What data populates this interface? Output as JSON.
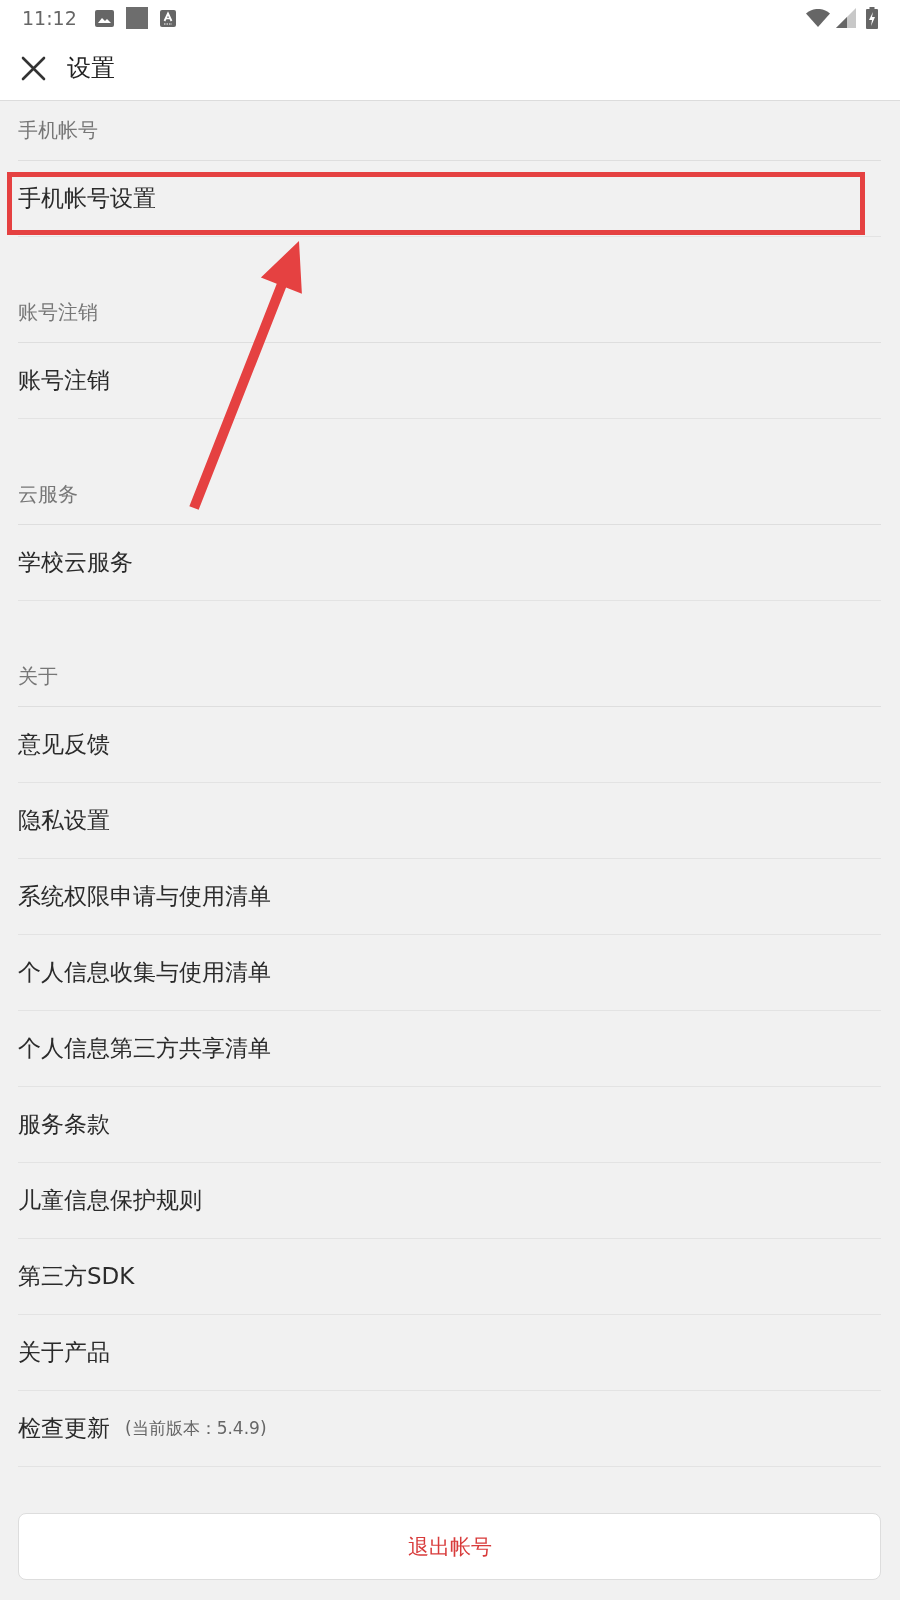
{
  "status_bar": {
    "time": "11:12"
  },
  "header": {
    "title": "设置"
  },
  "sections": [
    {
      "title": "手机帐号",
      "items": [
        {
          "label": "手机帐号设置",
          "highlighted": true
        }
      ]
    },
    {
      "title": "账号注销",
      "items": [
        {
          "label": "账号注销",
          "highlighted": false
        }
      ]
    },
    {
      "title": "云服务",
      "items": [
        {
          "label": "学校云服务",
          "highlighted": false
        }
      ]
    },
    {
      "title": "关于",
      "items": [
        {
          "label": "意见反馈",
          "highlighted": false
        },
        {
          "label": "隐私设置",
          "highlighted": false
        },
        {
          "label": "系统权限申请与使用清单",
          "highlighted": false
        },
        {
          "label": "个人信息收集与使用清单",
          "highlighted": false
        },
        {
          "label": "个人信息第三方共享清单",
          "highlighted": false
        },
        {
          "label": "服务条款",
          "highlighted": false
        },
        {
          "label": "儿童信息保护规则",
          "highlighted": false
        },
        {
          "label": "第三方SDK",
          "highlighted": false
        },
        {
          "label": "关于产品",
          "highlighted": false
        },
        {
          "label": "检查更新",
          "note": "(当前版本：5.4.9)",
          "highlighted": false
        }
      ]
    }
  ],
  "logout_button": {
    "label": "退出帐号"
  }
}
